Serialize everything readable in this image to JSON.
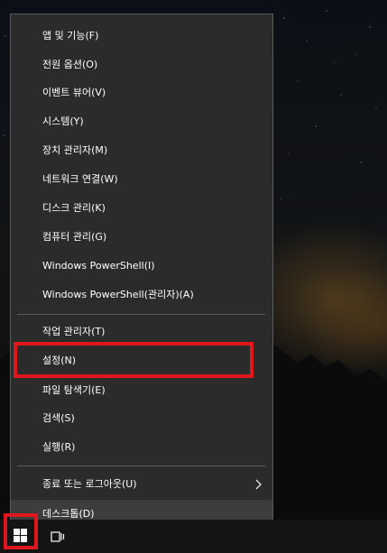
{
  "menu": {
    "group1": [
      {
        "label": "앱 및 기능(F)"
      },
      {
        "label": "전원 옵션(O)"
      },
      {
        "label": "이벤트 뷰어(V)"
      },
      {
        "label": "시스템(Y)"
      },
      {
        "label": "장치 관리자(M)"
      },
      {
        "label": "네트워크 연결(W)"
      },
      {
        "label": "디스크 관리(K)"
      },
      {
        "label": "컴퓨터 관리(G)"
      },
      {
        "label": "Windows PowerShell(I)"
      },
      {
        "label": "Windows PowerShell(관리자)(A)"
      }
    ],
    "group2": [
      {
        "label": "작업 관리자(T)"
      },
      {
        "label": "설정(N)"
      },
      {
        "label": "파일 탐색기(E)"
      },
      {
        "label": "검색(S)"
      },
      {
        "label": "실행(R)"
      }
    ],
    "group3": [
      {
        "label": "종료 또는 로그아웃(U)"
      },
      {
        "label": "데스크톱(D)"
      }
    ]
  },
  "colors": {
    "menu_background": "#2b2b2b",
    "highlight": "#e0161d",
    "text": "#ffffff"
  },
  "icons": {
    "submenu": "chevron-right-icon",
    "start": "windows-logo-icon",
    "task_view": "task-view-icon"
  }
}
